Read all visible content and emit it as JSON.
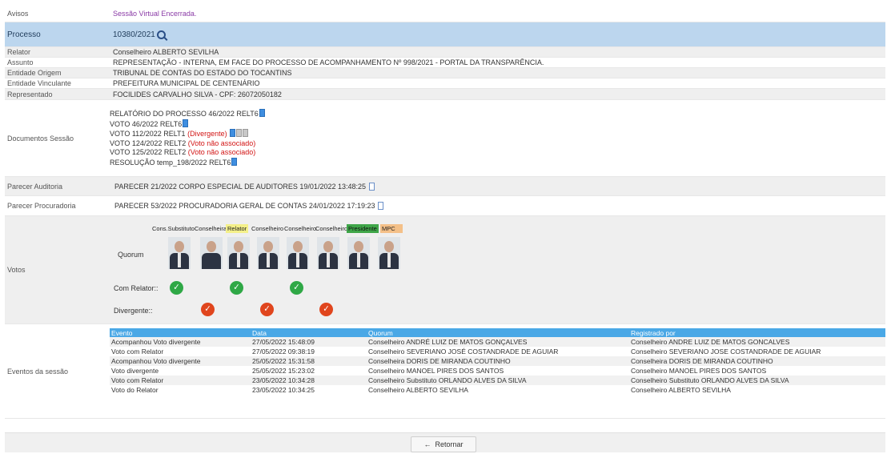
{
  "avisos": {
    "label": "Avisos",
    "value": "Sessão Virtual Encerrada."
  },
  "processo": {
    "label": "Processo",
    "value": "10380/2021"
  },
  "relator": {
    "label": "Relator",
    "value": "Conselheiro ALBERTO SEVILHA"
  },
  "assunto": {
    "label": "Assunto",
    "value": "REPRESENTAÇÃO - INTERNA, EM FACE DO PROCESSO DE ACOMPANHAMENTO Nº 998/2021 - PORTAL DA TRANSPARÊNCIA."
  },
  "entidade_origem": {
    "label": "Entidade Origem",
    "value": "TRIBUNAL DE CONTAS DO ESTADO DO TOCANTINS"
  },
  "entidade_vinculante": {
    "label": "Entidade Vinculante",
    "value": "PREFEITURA MUNICIPAL DE CENTENÁRIO"
  },
  "representado": {
    "label": "Representado",
    "value": "FOCILIDES CARVALHO SILVA - CPF: 26072050182"
  },
  "documentos": {
    "label": "Documentos Sessão",
    "items": [
      {
        "text": "RELATÓRIO DO PROCESSO 46/2022 RELT6",
        "note": ""
      },
      {
        "text": "VOTO 46/2022 RELT6",
        "note": ""
      },
      {
        "text": "VOTO 112/2022 RELT1",
        "note": "(Divergente)"
      },
      {
        "text": "VOTO 124/2022 RELT2",
        "note": "(Voto não associado)"
      },
      {
        "text": "VOTO 125/2022 RELT2",
        "note": "(Voto não associado)"
      },
      {
        "text": "RESOLUÇÃO temp_198/2022 RELT6",
        "note": ""
      }
    ]
  },
  "parecer_auditoria": {
    "label": "Parecer Auditoria",
    "value": "PARECER 21/2022 CORPO ESPECIAL DE AUDITORES 19/01/2022 13:48:25"
  },
  "parecer_procuradoria": {
    "label": "Parecer Procuradoria",
    "value": "PARECER 53/2022 PROCURADORIA GERAL DE CONTAS 24/01/2022 17:19:23"
  },
  "votos": {
    "label": "Votos",
    "quorum_label": "Quorum",
    "com_relator_label": "Com Relator::",
    "divergente_label": "Divergente::",
    "members": [
      {
        "role": "Cons.Substituto",
        "com_relator": true,
        "divergente": false
      },
      {
        "role": "Conselheira",
        "com_relator": false,
        "divergente": true
      },
      {
        "role": "Relator",
        "com_relator": true,
        "divergente": false
      },
      {
        "role": "Conselheiro",
        "com_relator": false,
        "divergente": true
      },
      {
        "role": "Conselheiro",
        "com_relator": true,
        "divergente": false
      },
      {
        "role": "Conselheiro",
        "com_relator": false,
        "divergente": true
      },
      {
        "role": "Presidente",
        "com_relator": false,
        "divergente": false
      },
      {
        "role": "MPC",
        "com_relator": false,
        "divergente": false
      }
    ]
  },
  "eventos": {
    "label": "Eventos da sessão",
    "headers": [
      "Evento",
      "Data",
      "Quorum",
      "Registrado por"
    ],
    "rows": [
      [
        "Acompanhou Voto divergente",
        "27/05/2022 15:48:09",
        "Conselheiro ANDRÉ LUIZ DE MATOS GONÇALVES",
        "Conselheiro ANDRE LUIZ DE MATOS GONCALVES"
      ],
      [
        "Voto com Relator",
        "27/05/2022 09:38:19",
        "Conselheiro SEVERIANO JOSÉ COSTANDRADE DE AGUIAR",
        "Conselheiro SEVERIANO JOSE COSTANDRADE DE AGUIAR"
      ],
      [
        "Acompanhou Voto divergente",
        "25/05/2022 15:31:58",
        "Conselheira DORIS DE MIRANDA COUTINHO",
        "Conselheira DORIS DE MIRANDA COUTINHO"
      ],
      [
        "Voto divergente",
        "25/05/2022 15:23:02",
        "Conselheiro MANOEL PIRES DOS SANTOS",
        "Conselheiro MANOEL PIRES DOS SANTOS"
      ],
      [
        "Voto com Relator",
        "23/05/2022 10:34:28",
        "Conselheiro Substituto ORLANDO ALVES DA SILVA",
        "Conselheiro Substituto ORLANDO ALVES DA SILVA"
      ],
      [
        "Voto do Relator",
        "23/05/2022 10:34:25",
        "Conselheiro ALBERTO SEVILHA",
        "Conselheiro ALBERTO SEVILHA"
      ]
    ]
  },
  "footer": {
    "back_label": "Retornar"
  }
}
